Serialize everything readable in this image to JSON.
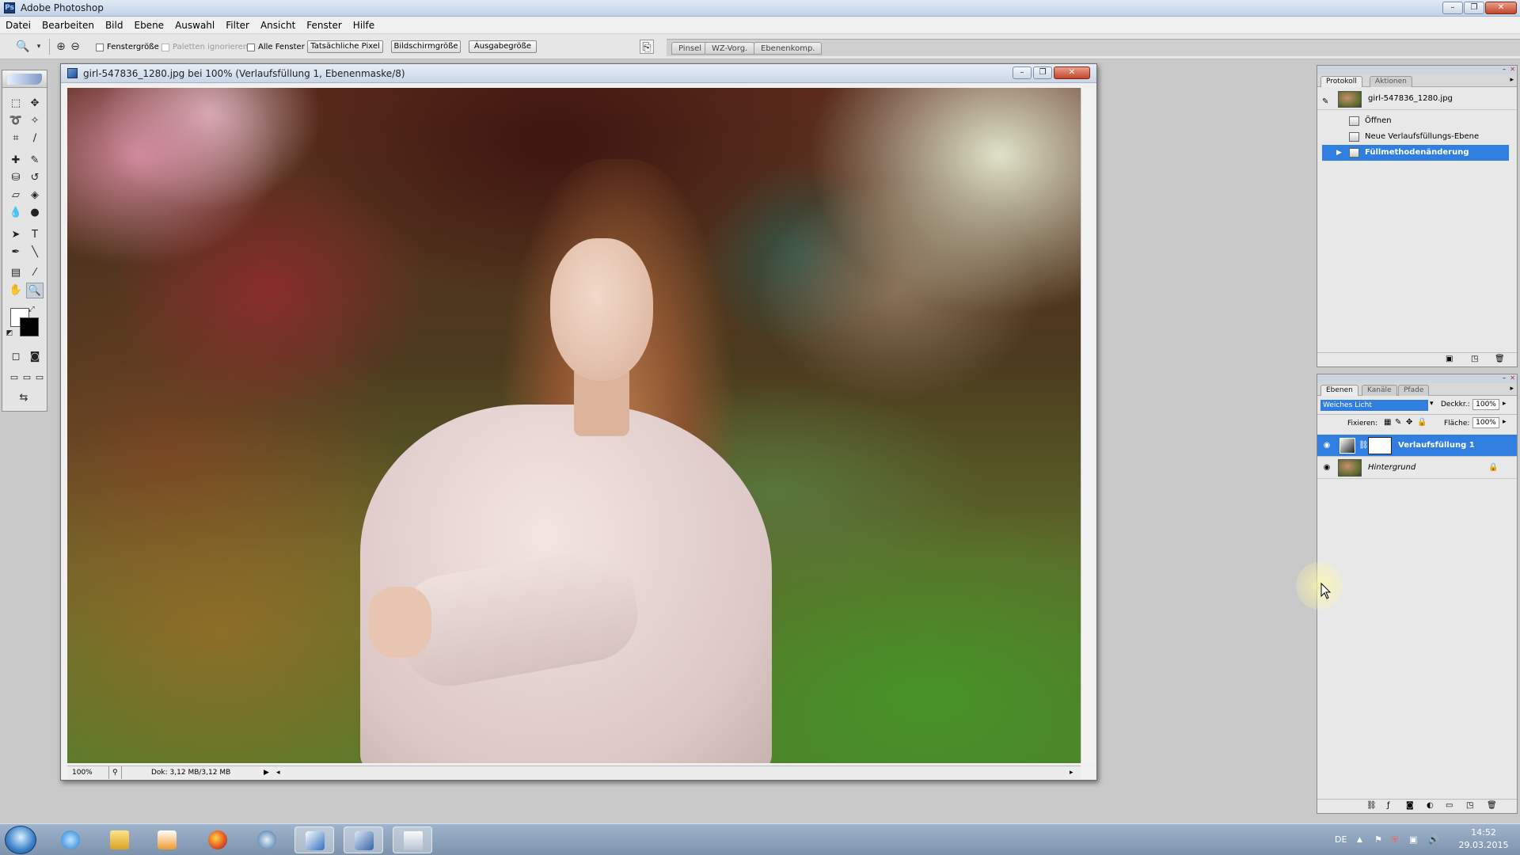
{
  "app": {
    "title": "Adobe Photoshop",
    "logo_icon": "photoshop-icon",
    "window_controls": [
      "minimize-icon",
      "maximize-icon",
      "close-icon"
    ]
  },
  "menu": [
    "Datei",
    "Bearbeiten",
    "Bild",
    "Ebene",
    "Auswahl",
    "Filter",
    "Ansicht",
    "Fenster",
    "Hilfe"
  ],
  "options_bar": {
    "checkboxes": {
      "fenstergroesse": "Fenstergröße",
      "paletten_ignorieren": "Paletten ignorieren",
      "alle_fenster": "Alle Fenster"
    },
    "buttons": {
      "tatsaechliche_pixel": "Tatsächliche Pixel",
      "bildschirmgroesse": "Bildschirmgröße",
      "ausgabegroesse": "Ausgabegröße"
    },
    "palette_well_tabs": [
      "Pinsel",
      "WZ-Vorg.",
      "Ebenenkomp."
    ]
  },
  "document": {
    "title": "girl-547836_1280.jpg bei 100% (Verlaufsfüllung 1, Ebenenmaske/8)",
    "zoom": "100%",
    "doc_size": "Dok: 3,12 MB/3,12 MB"
  },
  "history_panel": {
    "tabs": [
      "Protokoll",
      "Aktionen"
    ],
    "snapshot": "girl-547836_1280.jpg",
    "items": [
      "Öffnen",
      "Neue Verlaufsfüllungs-Ebene",
      "Füllmethodenänderung"
    ],
    "selected_index": 2
  },
  "layers_panel": {
    "tabs": [
      "Ebenen",
      "Kanäle",
      "Pfade"
    ],
    "blend_mode": "Weiches Licht",
    "opacity_label": "Deckkr.:",
    "opacity_value": "100%",
    "lock_label": "Fixieren:",
    "fill_label": "Fläche:",
    "fill_value": "100%",
    "layers": [
      {
        "name": "Verlaufsfüllung 1",
        "selected": true
      },
      {
        "name": "Hintergrund",
        "selected": false,
        "locked": true
      }
    ]
  },
  "taskbar": {
    "language": "DE",
    "time": "14:52",
    "date": "29.03.2015",
    "apps": [
      "windows-start-icon",
      "internet-explorer-icon",
      "file-explorer-icon",
      "media-player-icon",
      "firefox-icon",
      "browser-icon",
      "photoshop-taskbar-icon",
      "network-app-icon",
      "window-app-icon"
    ]
  },
  "colors": {
    "selection": "#2f7ee0",
    "accent_titlebar": "#c2d3e8",
    "taskbar": "#8ea3bc"
  }
}
